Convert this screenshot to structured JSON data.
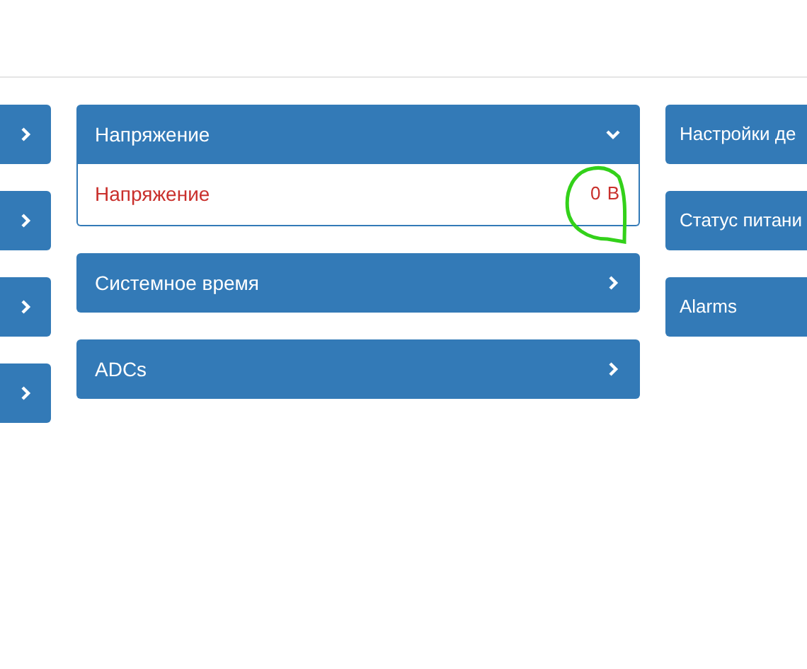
{
  "center_panels": [
    {
      "title": "Напряжение",
      "expanded": true,
      "rows": [
        {
          "label": "Напряжение",
          "value": "0 В"
        }
      ]
    },
    {
      "title": "Системное время",
      "expanded": false
    },
    {
      "title": "ADCs",
      "expanded": false
    }
  ],
  "right_panels": [
    {
      "title": "Настройки де"
    },
    {
      "title": "Статус питани"
    },
    {
      "title": "Alarms"
    }
  ]
}
